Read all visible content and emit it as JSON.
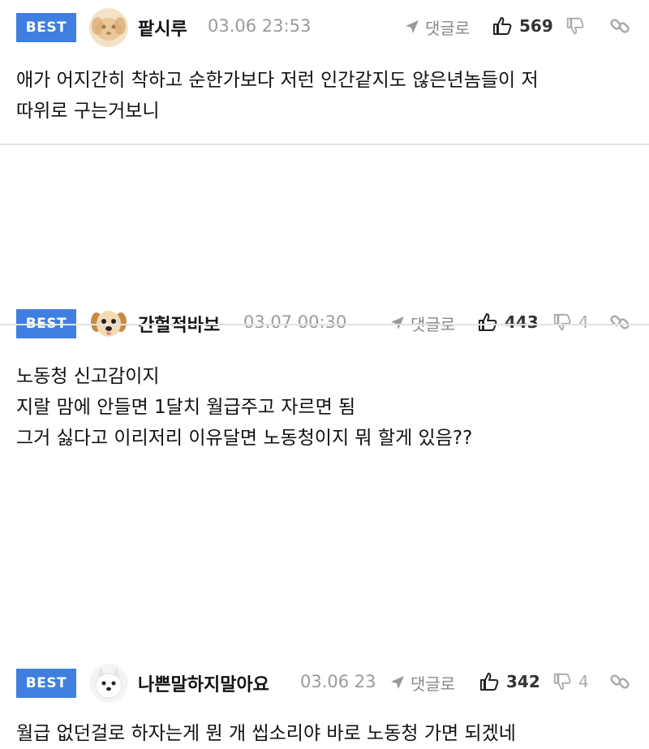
{
  "comments": [
    {
      "badge": "BEST",
      "nickname": "팥시루",
      "timestamp": "03.06 23:53",
      "reply_label": "댓글로",
      "likes": "569",
      "dislikes": "",
      "lines": [
        "애가 어지간히 착하고 순한가보다 저런 인간같지도 않은년놈들이 저",
        "따위로 구는거보니"
      ]
    },
    {
      "badge": "BEST",
      "nickname": "간헐적바보",
      "timestamp": "03.07 00:30",
      "reply_label": "댓글로",
      "likes": "443",
      "dislikes": "4",
      "lines": [
        "노동청 신고감이지",
        "지랄 맘에 안들면 1달치 월급주고 자르면 됨",
        "그거 싫다고 이리저리 이유달면 노동청이지 뭐 할게 있음??"
      ]
    },
    {
      "badge": "BEST",
      "nickname": "나쁜말하지말아요",
      "timestamp": "03.06 23",
      "reply_label": "댓글로",
      "likes": "342",
      "dislikes": "4",
      "lines": [
        "월급 없던걸로 하자는게 뭔 개 씹소리야 바로 노동청 가면 되겠네"
      ]
    }
  ],
  "icons": {
    "reply": "send-arrow-icon",
    "like": "thumbs-up-icon",
    "dislike": "thumbs-down-icon",
    "link": "link-icon"
  },
  "colors": {
    "best_badge": "#3f7fe0",
    "meta_gray": "#9a9a9a",
    "divider": "#e2e2e2"
  }
}
